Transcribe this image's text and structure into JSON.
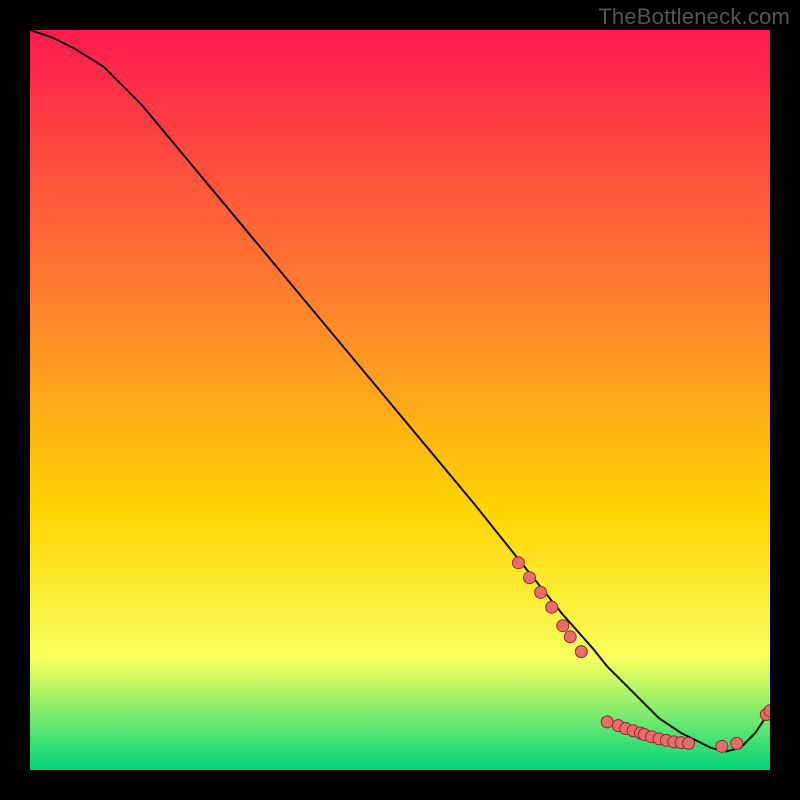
{
  "watermark": "TheBottleneck.com",
  "chart_data": {
    "type": "line",
    "title": "",
    "xlabel": "",
    "ylabel": "",
    "xlim": [
      0,
      100
    ],
    "ylim": [
      0,
      100
    ],
    "grid": false,
    "series": [
      {
        "name": "curve",
        "x": [
          0,
          3,
          6,
          10,
          15,
          20,
          25,
          30,
          35,
          40,
          45,
          50,
          55,
          60,
          64,
          68,
          72,
          76,
          78,
          80,
          82,
          85,
          88,
          90,
          92,
          94,
          96,
          98,
          100
        ],
        "y": [
          100,
          99,
          97.5,
          95,
          90,
          84,
          78,
          72,
          66,
          60,
          54,
          48,
          42,
          36,
          31,
          26,
          21,
          16.5,
          14,
          12,
          10,
          7,
          5,
          4,
          3,
          2.5,
          3,
          5,
          8
        ]
      }
    ],
    "markers": [
      {
        "x": 66,
        "y": 28
      },
      {
        "x": 67.5,
        "y": 26
      },
      {
        "x": 69,
        "y": 24
      },
      {
        "x": 70.5,
        "y": 22
      },
      {
        "x": 72,
        "y": 19.5
      },
      {
        "x": 73,
        "y": 18
      },
      {
        "x": 74.5,
        "y": 16
      },
      {
        "x": 78,
        "y": 6.5
      },
      {
        "x": 79.5,
        "y": 6
      },
      {
        "x": 80.5,
        "y": 5.6
      },
      {
        "x": 81.5,
        "y": 5.3
      },
      {
        "x": 82.5,
        "y": 5.0
      },
      {
        "x": 83,
        "y": 4.8
      },
      {
        "x": 84,
        "y": 4.5
      },
      {
        "x": 85,
        "y": 4.2
      },
      {
        "x": 86,
        "y": 4.0
      },
      {
        "x": 87,
        "y": 3.8
      },
      {
        "x": 88,
        "y": 3.7
      },
      {
        "x": 89,
        "y": 3.6
      },
      {
        "x": 93.5,
        "y": 3.2
      },
      {
        "x": 95.5,
        "y": 3.6
      },
      {
        "x": 99.5,
        "y": 7.5
      },
      {
        "x": 100,
        "y": 8.0
      }
    ],
    "background_gradient": {
      "top": "#ff1a4f",
      "mid1": "#ff8a2a",
      "mid2": "#ffd400",
      "mid3": "#f7ff5e",
      "bottom": "#00d67a"
    },
    "line_color": "#111111",
    "marker_color": "#e86a6a",
    "marker_edge": "#8e2f2f"
  }
}
